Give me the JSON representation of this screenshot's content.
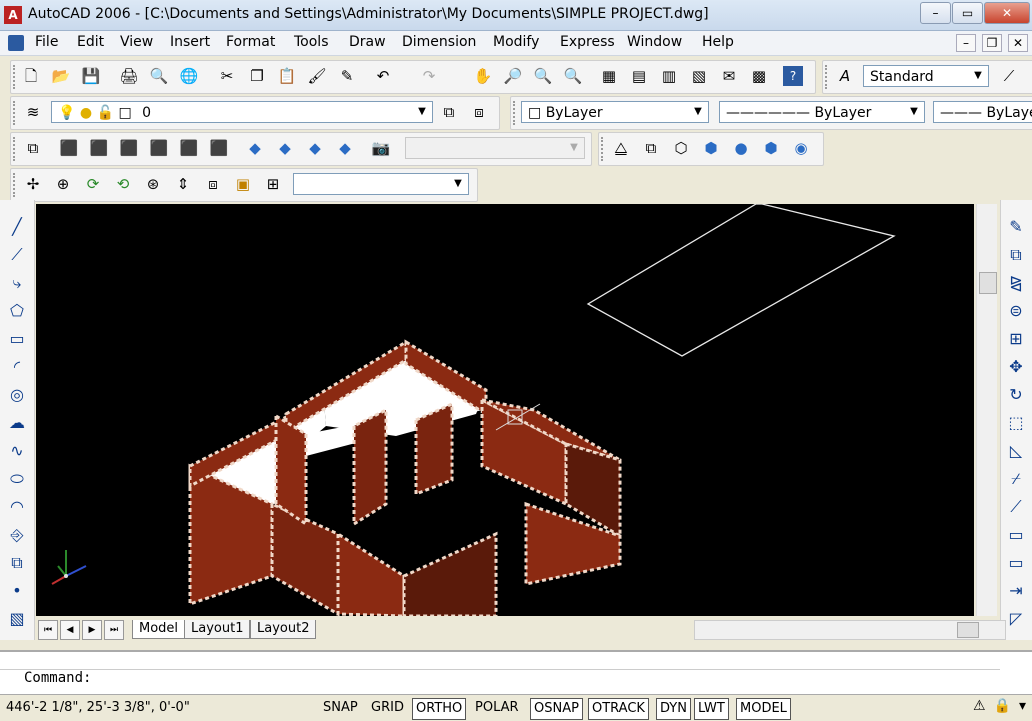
{
  "titlebar": {
    "app_title": "AutoCAD 2006 - [C:\\Documents and Settings\\Administrator\\My Documents\\SIMPLE PROJECT.dwg]",
    "minimize": "–",
    "restore": "▭",
    "close": "✕"
  },
  "menubar": {
    "items": [
      "File",
      "Edit",
      "View",
      "Insert",
      "Format",
      "Tools",
      "Draw",
      "Dimension",
      "Modify",
      "Express",
      "Window",
      "Help"
    ],
    "mdi_minimize": "–",
    "mdi_restore": "❐",
    "mdi_close": "✕"
  },
  "styles_toolbar": {
    "text_style": "Standard"
  },
  "layers_toolbar": {
    "current_layer": "0"
  },
  "properties_toolbar": {
    "color": "ByLayer",
    "linetype": "ByLayer",
    "lineweight": "ByLayer"
  },
  "views_toolbar": {
    "named_view": ""
  },
  "ucs_toolbar": {
    "ucs_name": ""
  },
  "layout_tabs": [
    "Model",
    "Layout1",
    "Layout2"
  ],
  "command": {
    "prompt": "Command:"
  },
  "status": {
    "coordinates": "446'-2 1/8\",  25'-3 3/8\", 0'-0\"",
    "toggles": [
      "SNAP",
      "GRID",
      "ORTHO",
      "POLAR",
      "OSNAP",
      "OTRACK",
      "DYN",
      "LWT",
      "MODEL"
    ],
    "toggles_on": [
      "ORTHO",
      "OSNAP",
      "OTRACK",
      "DYN",
      "LWT",
      "MODEL"
    ]
  },
  "colors": {
    "canvas": "#000000",
    "wall_fill": "#8b2a12",
    "dashed_edge": "#f0d8c8"
  }
}
